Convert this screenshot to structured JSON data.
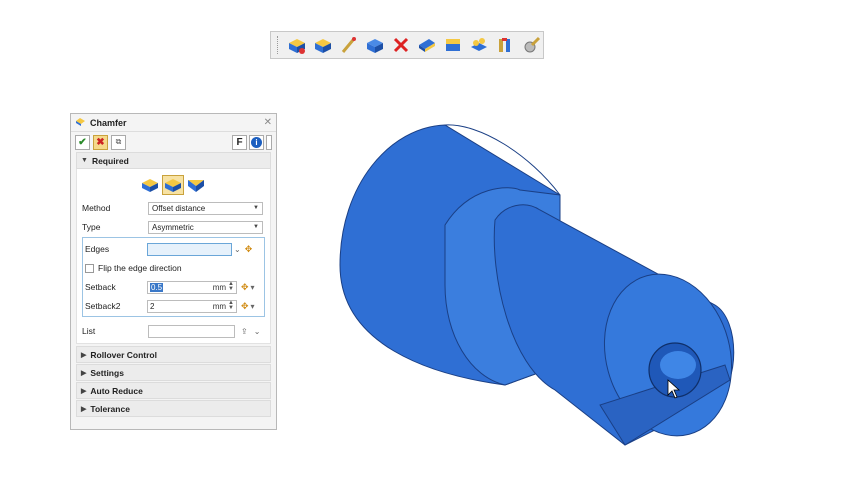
{
  "toolbar": {
    "icons": [
      "chamfer-icon",
      "fillet-icon",
      "wand-icon",
      "solid-icon",
      "delete-icon",
      "face-icon",
      "shell-icon",
      "pattern-icon",
      "tools-icon",
      "settings-icon"
    ]
  },
  "panel": {
    "title": "Chamfer",
    "close": "✕",
    "ok_icon": "check-icon",
    "cancel_icon": "x-icon",
    "f_label": "F",
    "info_label": "i",
    "required_label": "Required",
    "method_label": "Method",
    "method_value": "Offset distance",
    "type_label": "Type",
    "type_value": "Asymmetric",
    "edges_label": "Edges",
    "edges_value": "",
    "flip_label": "Flip the edge direction",
    "flip_checked": false,
    "setback_label": "Setback",
    "setback_value": "0.5",
    "setback_unit": "mm",
    "setback2_label": "Setback2",
    "setback2_value": "2",
    "setback2_unit": "mm",
    "list_label": "List",
    "sections": [
      "Rollover Control",
      "Settings",
      "Auto Reduce",
      "Tolerance"
    ]
  },
  "colors": {
    "part_main": "#2f6fd4",
    "part_dark": "#1c4fa6",
    "part_light": "#4a8ae6",
    "accent": "#f5d98a"
  }
}
